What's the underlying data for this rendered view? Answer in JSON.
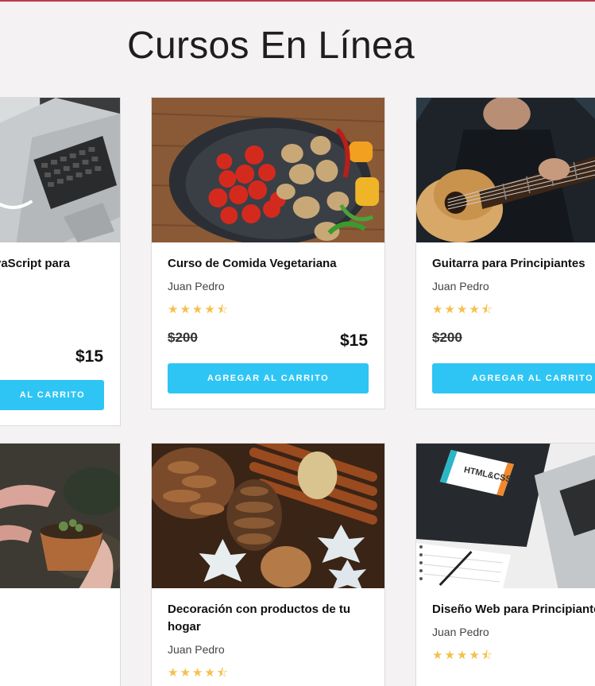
{
  "page": {
    "title": "Cursos En Línea"
  },
  "courses": [
    {
      "title": "vaScript para",
      "author": "",
      "stars": "★★★★⯪",
      "old_price": "",
      "new_price": "$15",
      "button": "AL CARRITO"
    },
    {
      "title": "Curso de Comida Vegetariana",
      "author": "Juan Pedro",
      "stars": "★★★★⯪",
      "old_price": "$200",
      "new_price": "$15",
      "button": "AGREGAR AL CARRITO"
    },
    {
      "title": "Guitarra para Principiantes",
      "author": "Juan Pedro",
      "stars": "★★★★⯪",
      "old_price": "$200",
      "new_price": "",
      "button": "AGREGAR AL CARRITO"
    },
    {
      "title": "",
      "author": "",
      "stars": "",
      "old_price": "",
      "new_price": "",
      "button": ""
    },
    {
      "title_line1": "Decoración con productos de tu",
      "title_line2": "hogar",
      "author": "Juan Pedro",
      "stars": "★★★★⯪"
    },
    {
      "title": "Diseño Web para Principiantes",
      "author": "Juan Pedro",
      "stars": "★★★★⯪"
    }
  ],
  "images": {
    "book_cover_text": "HTML&CSS"
  },
  "colors": {
    "button": "#2ec5f4",
    "stars": "#f5c04b",
    "background": "#f4f2f3"
  }
}
